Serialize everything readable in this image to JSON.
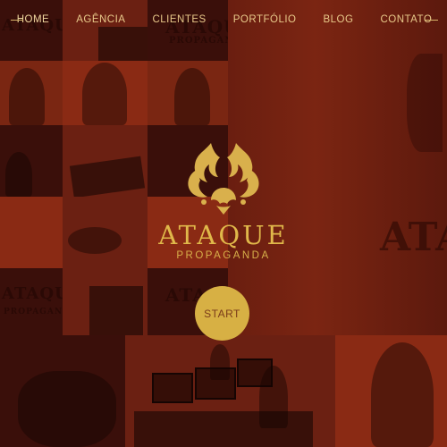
{
  "nav": {
    "items": [
      {
        "label": "HOME"
      },
      {
        "label": "AGÊNCIA"
      },
      {
        "label": "CLIENTES"
      },
      {
        "label": "PORTFÓLIO"
      },
      {
        "label": "BLOG"
      },
      {
        "label": "CONTATO"
      }
    ]
  },
  "brand": {
    "name": "ATAQUE",
    "subtitle": "PROPAGANDA",
    "logo_icon": "lion-flame-icon",
    "colors": {
      "gold": "#e0b84a",
      "red_tint": "#6b2012"
    }
  },
  "start_button": {
    "label": "START"
  },
  "background": {
    "ghost_logo_text": "ATAQUE",
    "ghost_logo_sub": "PROPAGANDA"
  }
}
